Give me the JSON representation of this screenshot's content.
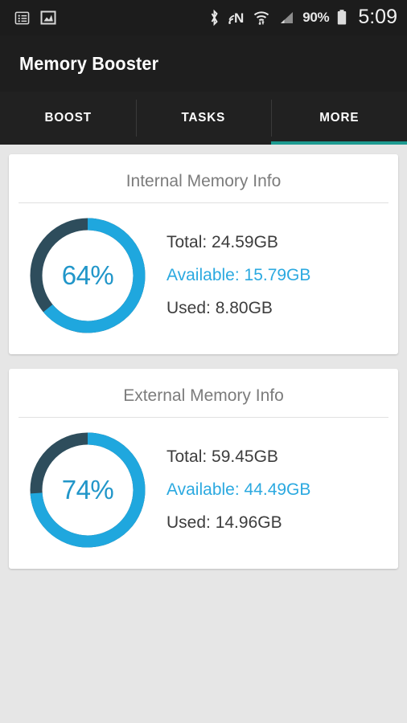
{
  "statusbar": {
    "left_icons": [
      {
        "name": "list-notification-icon",
        "glyph": "list"
      },
      {
        "name": "image-notification-icon",
        "glyph": "image"
      }
    ],
    "right_icons": [
      {
        "name": "bluetooth-icon",
        "glyph": "bluetooth"
      },
      {
        "name": "nfc-icon",
        "glyph": "nfc"
      },
      {
        "name": "wifi-icon",
        "glyph": "wifi"
      },
      {
        "name": "cellular-signal-icon",
        "glyph": "signal"
      }
    ],
    "battery_percent": "90%",
    "battery_icon": "battery-icon",
    "clock": "5:09"
  },
  "header": {
    "app_title": "Memory Booster"
  },
  "tabs": {
    "active_index": 2,
    "accent_color": "#1d9a90",
    "items": [
      {
        "label": "BOOST",
        "name": "tab-boost"
      },
      {
        "label": "TASKS",
        "name": "tab-tasks"
      },
      {
        "label": "MORE",
        "name": "tab-more"
      }
    ]
  },
  "colors": {
    "page_background": "#e6e6e6",
    "card_background": "#ffffff",
    "donut_used_arc": "#1fa7de",
    "donut_free_arc": "#2e4d5c",
    "percent_text": "#2196c9",
    "available_text": "#2ba9e0",
    "stat_text": "#3d3d3d",
    "title_text": "#7c7c7c"
  },
  "cards": [
    {
      "name": "internal-memory-card",
      "title": "Internal Memory Info",
      "percent_label": "64%",
      "percent_value": 64,
      "stats": [
        {
          "label": "Total: 24.59GB",
          "kind": "total"
        },
        {
          "label": "Available: 15.79GB",
          "kind": "available"
        },
        {
          "label": "Used: 8.80GB",
          "kind": "used"
        }
      ]
    },
    {
      "name": "external-memory-card",
      "title": "External Memory Info",
      "percent_label": "74%",
      "percent_value": 74,
      "stats": [
        {
          "label": "Total: 59.45GB",
          "kind": "total"
        },
        {
          "label": "Available: 44.49GB",
          "kind": "available"
        },
        {
          "label": "Used: 14.96GB",
          "kind": "used"
        }
      ]
    }
  ],
  "chart_data": [
    {
      "type": "pie",
      "title": "Internal Memory Info",
      "categories": [
        "Used",
        "Free"
      ],
      "values": [
        64,
        36
      ],
      "unit": "%",
      "center_label": "64%",
      "total_gb": 24.59,
      "available_gb": 15.79,
      "used_gb": 8.8,
      "colors": [
        "#1fa7de",
        "#2e4d5c"
      ],
      "legend": [
        "Total: 24.59GB",
        "Available: 15.79GB",
        "Used: 8.80GB"
      ]
    },
    {
      "type": "pie",
      "title": "External Memory Info",
      "categories": [
        "Used",
        "Free"
      ],
      "values": [
        74,
        26
      ],
      "unit": "%",
      "center_label": "74%",
      "total_gb": 59.45,
      "available_gb": 44.49,
      "used_gb": 14.96,
      "colors": [
        "#1fa7de",
        "#2e4d5c"
      ],
      "legend": [
        "Total: 59.45GB",
        "Available: 44.49GB",
        "Used: 14.96GB"
      ]
    }
  ]
}
